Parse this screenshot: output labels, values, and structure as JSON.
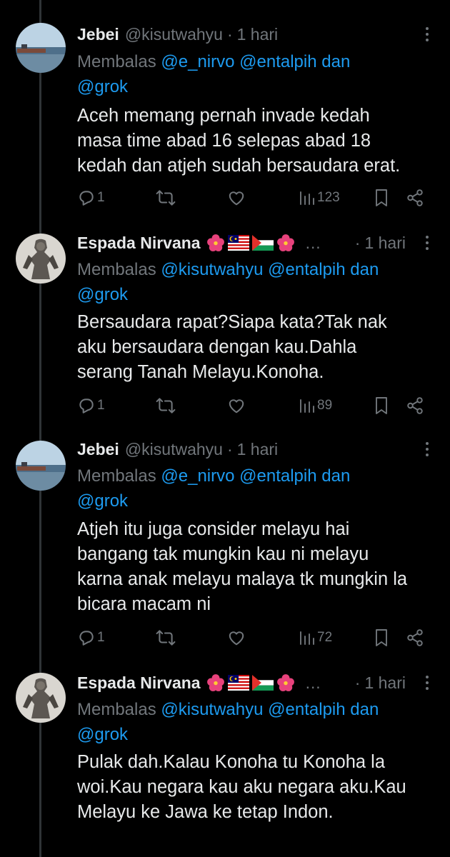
{
  "colors": {
    "background": "#000000",
    "text": "#e7e9ea",
    "muted": "#71767b",
    "link": "#1d9bf0"
  },
  "replying_prefix": "Membalas",
  "and_word": "dan",
  "ellipsis": "…",
  "tweets": [
    {
      "name": "Jebei",
      "handle": "@kisutwahyu",
      "time": "1 hari",
      "reply_to": [
        "@e_nirvo",
        "@entalpih",
        "@grok"
      ],
      "text": [
        "Aceh memang pernah invade kedah",
        "masa time abad 16 selepas abad 18",
        "kedah dan atjeh sudah bersaudara erat."
      ],
      "replies": "1",
      "views": "123",
      "avatar_icon": "beach-avatar"
    },
    {
      "name": "Espada Nirvana",
      "handle": "",
      "time": "1 hari",
      "emojis": [
        "hibiscus",
        "malaysia-flag",
        "palestine-flag",
        "hibiscus"
      ],
      "reply_to": [
        "@kisutwahyu",
        "@entalpih",
        "@grok"
      ],
      "text": [
        "Bersaudara rapat?Siapa kata?Tak nak",
        "aku bersaudara dengan kau.Dahla",
        "serang Tanah Melayu.Konoha."
      ],
      "replies": "1",
      "views": "89",
      "avatar_icon": "statue-avatar"
    },
    {
      "name": "Jebei",
      "handle": "@kisutwahyu",
      "time": "1 hari",
      "reply_to": [
        "@e_nirvo",
        "@entalpih",
        "@grok"
      ],
      "text": [
        "Atjeh itu juga consider melayu hai",
        "bangang tak mungkin kau ni melayu",
        "karna anak melayu malaya tk mungkin la",
        "bicara macam ni"
      ],
      "replies": "1",
      "views": "72",
      "avatar_icon": "beach-avatar"
    },
    {
      "name": "Espada Nirvana",
      "handle": "",
      "time": "1 hari",
      "emojis": [
        "hibiscus",
        "malaysia-flag",
        "palestine-flag",
        "hibiscus"
      ],
      "reply_to": [
        "@kisutwahyu",
        "@entalpih",
        "@grok"
      ],
      "text": [
        "Pulak dah.Kalau Konoha tu Konoha la",
        "woi.Kau negara kau aku negara aku.Kau",
        "Melayu ke Jawa ke tetap Indon."
      ],
      "avatar_icon": "statue-avatar"
    }
  ]
}
